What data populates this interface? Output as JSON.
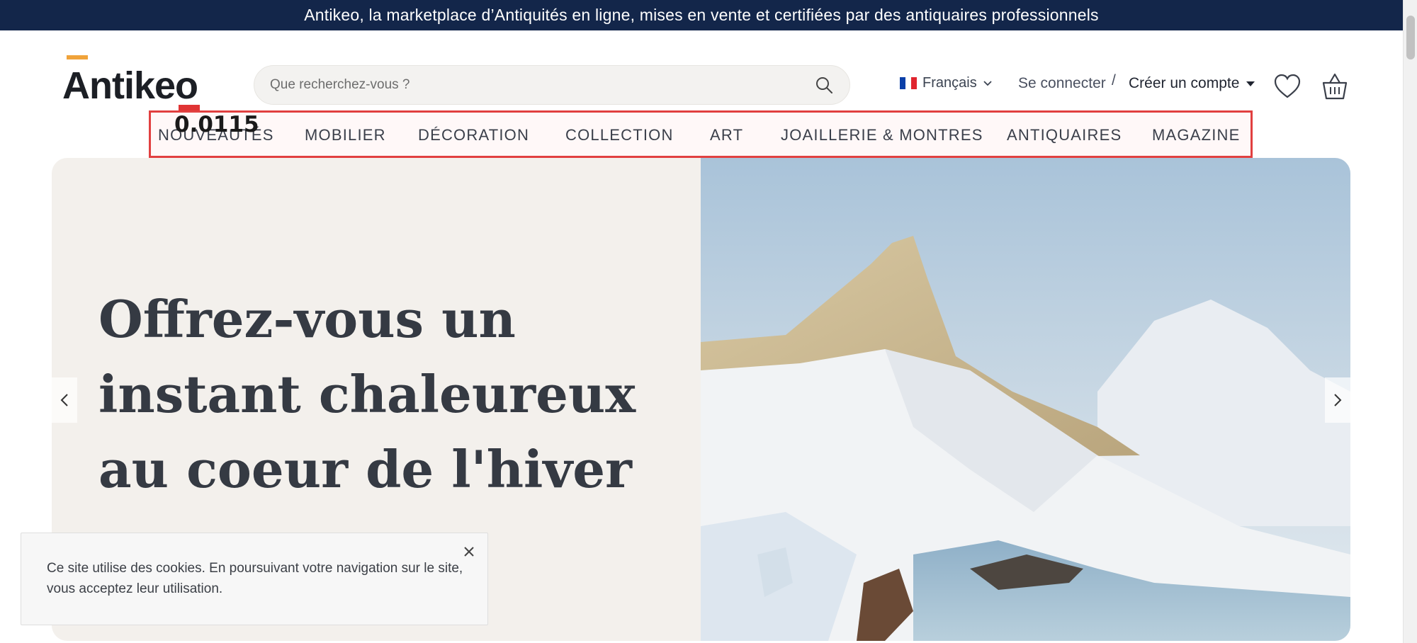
{
  "announcement": "Antikeo, la marketplace d’Antiquités en ligne, mises en vente et certifiées par des antiquaires professionnels",
  "logo": {
    "text": "Antikeo"
  },
  "overlay_score": "0.0115",
  "search": {
    "placeholder": "Que recherchez-vous ?",
    "icon": "search-icon"
  },
  "header": {
    "language": "Français",
    "language_flag": "france-flag-icon",
    "login": "Se connecter",
    "separator": "/",
    "signup": "Créer un compte",
    "wishlist_icon": "heart-icon",
    "cart_icon": "basket-icon"
  },
  "nav": {
    "items": [
      {
        "label": "NOUVEAUTÉS"
      },
      {
        "label": "MOBILIER"
      },
      {
        "label": "DÉCORATION"
      },
      {
        "label": "COLLECTION"
      },
      {
        "label": "ART"
      },
      {
        "label": "JOAILLERIE & MONTRES"
      },
      {
        "label": "ANTIQUAIRES"
      },
      {
        "label": "MAGAZINE"
      }
    ],
    "highlight_color": "#e14040"
  },
  "hero": {
    "headline": "Offrez-vous un instant chaleureux au coeur de l'hiver",
    "prev_icon": "chevron-left-icon",
    "next_icon": "chevron-right-icon"
  },
  "cookie": {
    "message": "Ce site utilise des cookies. En poursuivant votre navigation sur le site, vous acceptez leur utilisation.",
    "close_icon": "close-icon"
  },
  "colors": {
    "topbar": "#13264a",
    "logo_accent": "#f0a33a",
    "logo_accent_red": "#e03434",
    "hero_background": "#f3f0ec"
  }
}
